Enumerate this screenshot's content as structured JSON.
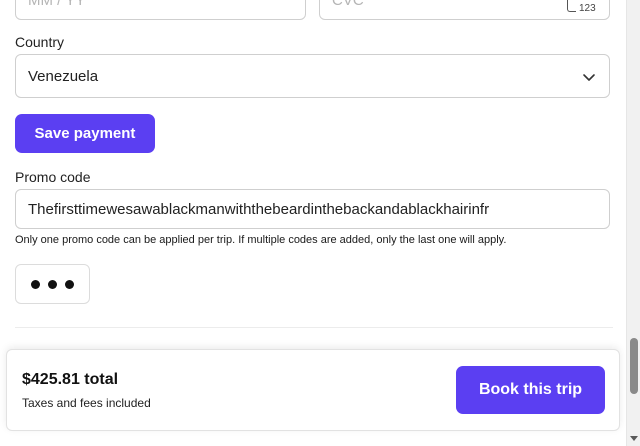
{
  "card": {
    "expiry_placeholder": "MM / YY",
    "cvc_placeholder": "CVC",
    "cvc_icon_text": "123"
  },
  "country": {
    "label": "Country",
    "selected": "Venezuela",
    "icon": "chevron-down-icon"
  },
  "save_button": "Save payment",
  "promo": {
    "label": "Promo code",
    "value": "Thefirsttimewesawablackmanwiththebeardinthebackandablackhairinfr",
    "help": "Only one promo code can be applied per trip. If multiple codes are added, only the last one will apply."
  },
  "more_icon": "more-dots-icon",
  "footer": {
    "total": "$425.81 total",
    "taxes": "Taxes and fees included",
    "book_button": "Book this trip"
  },
  "colors": {
    "accent": "#5b3ff2",
    "border": "#cfcfcf"
  }
}
